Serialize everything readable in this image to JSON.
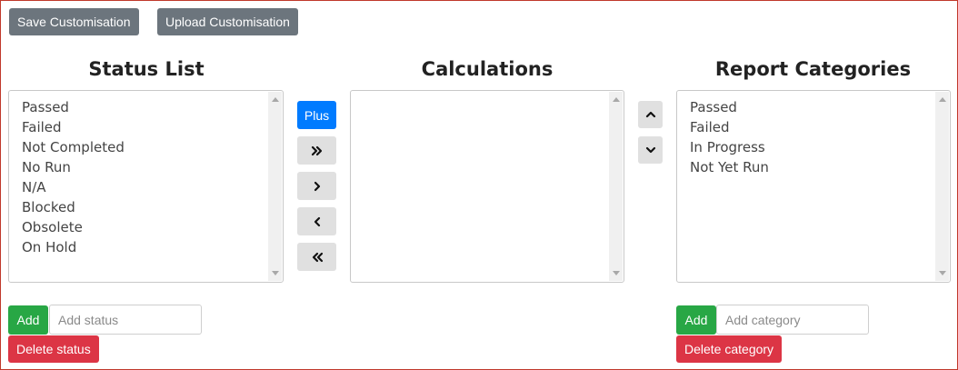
{
  "toolbar": {
    "save_label": "Save Customisation",
    "upload_label": "Upload Customisation"
  },
  "status_list": {
    "title": "Status List",
    "items": [
      "Passed",
      "Failed",
      "Not Completed",
      "No Run",
      "N/A",
      "Blocked",
      "Obsolete",
      "On Hold"
    ],
    "add_label": "Add",
    "add_placeholder": "Add status",
    "delete_label": "Delete status"
  },
  "calculations": {
    "title": "Calculations",
    "plus_label": "Plus",
    "move_all_right_icon": "double-chevron-right-icon",
    "move_right_icon": "chevron-right-icon",
    "move_left_icon": "chevron-left-icon",
    "move_all_left_icon": "double-chevron-left-icon"
  },
  "report_categories": {
    "title": "Report Categories",
    "items": [
      "Passed",
      "Failed",
      "In Progress",
      "Not Yet Run"
    ],
    "move_up_icon": "chevron-up-icon",
    "move_down_icon": "chevron-down-icon",
    "add_label": "Add",
    "add_placeholder": "Add category",
    "delete_label": "Delete category"
  },
  "colors": {
    "secondary": "#6c757d",
    "primary": "#007bff",
    "success": "#28a745",
    "danger": "#dc3545",
    "frame_border": "#c0392b"
  }
}
